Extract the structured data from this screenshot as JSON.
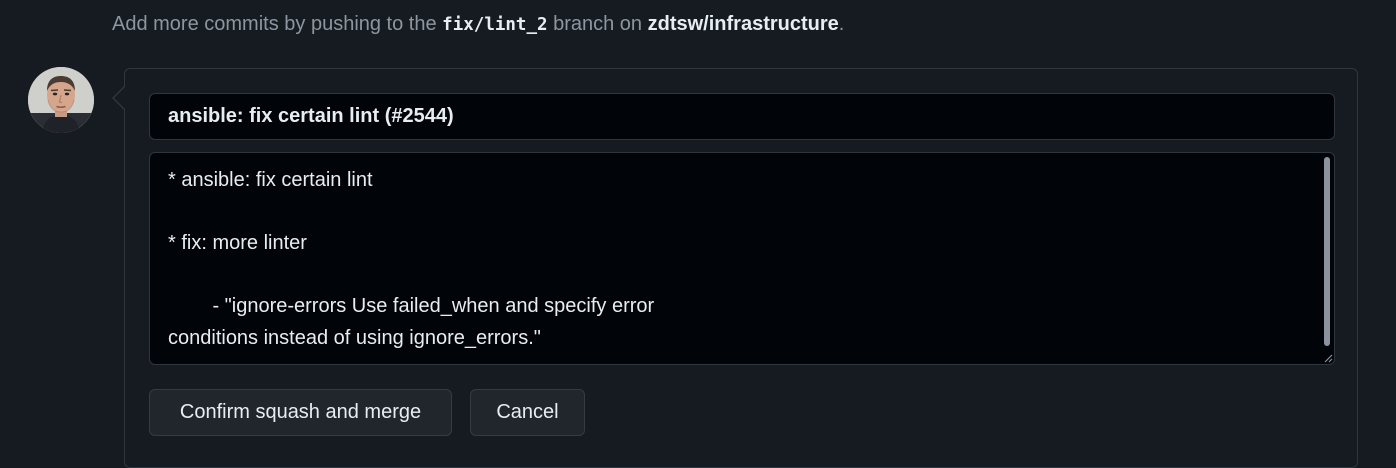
{
  "hint": {
    "prefix": "Add more commits by pushing to the",
    "branch": "fix/lint_2",
    "middle": "branch on",
    "repo": "zdtsw/infrastructure",
    "suffix": "."
  },
  "merge_form": {
    "commit_title": "ansible: fix certain lint (#2544)",
    "commit_message": "* ansible: fix certain lint\n\n* fix: more linter\n\n        - \"ignore-errors Use failed_when and specify error\nconditions instead of using ignore_errors.\"",
    "confirm_label": "Confirm squash and merge",
    "cancel_label": "Cancel"
  },
  "colors": {
    "background": "#161b22",
    "input_background": "#010409",
    "border": "#30363d",
    "button_background": "#21262d",
    "text": "#e6edf3",
    "muted_text": "#8d96a0"
  },
  "icons": {
    "avatar": "user-avatar-photo"
  }
}
